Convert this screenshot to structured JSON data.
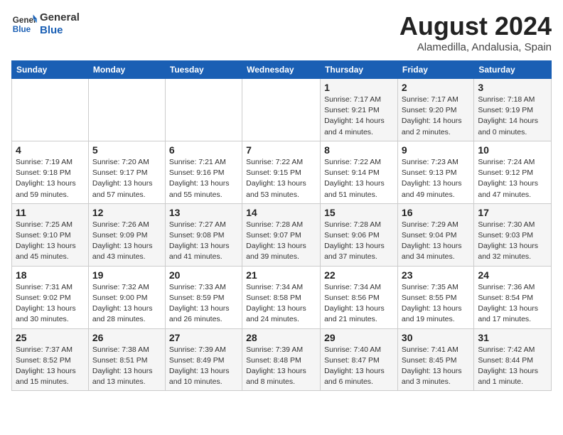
{
  "logo": {
    "line1": "General",
    "line2": "Blue"
  },
  "title": {
    "month_year": "August 2024",
    "location": "Alamedilla, Andalusia, Spain"
  },
  "days_of_week": [
    "Sunday",
    "Monday",
    "Tuesday",
    "Wednesday",
    "Thursday",
    "Friday",
    "Saturday"
  ],
  "weeks": [
    [
      {
        "day": "",
        "info": ""
      },
      {
        "day": "",
        "info": ""
      },
      {
        "day": "",
        "info": ""
      },
      {
        "day": "",
        "info": ""
      },
      {
        "day": "1",
        "info": "Sunrise: 7:17 AM\nSunset: 9:21 PM\nDaylight: 14 hours\nand 4 minutes."
      },
      {
        "day": "2",
        "info": "Sunrise: 7:17 AM\nSunset: 9:20 PM\nDaylight: 14 hours\nand 2 minutes."
      },
      {
        "day": "3",
        "info": "Sunrise: 7:18 AM\nSunset: 9:19 PM\nDaylight: 14 hours\nand 0 minutes."
      }
    ],
    [
      {
        "day": "4",
        "info": "Sunrise: 7:19 AM\nSunset: 9:18 PM\nDaylight: 13 hours\nand 59 minutes."
      },
      {
        "day": "5",
        "info": "Sunrise: 7:20 AM\nSunset: 9:17 PM\nDaylight: 13 hours\nand 57 minutes."
      },
      {
        "day": "6",
        "info": "Sunrise: 7:21 AM\nSunset: 9:16 PM\nDaylight: 13 hours\nand 55 minutes."
      },
      {
        "day": "7",
        "info": "Sunrise: 7:22 AM\nSunset: 9:15 PM\nDaylight: 13 hours\nand 53 minutes."
      },
      {
        "day": "8",
        "info": "Sunrise: 7:22 AM\nSunset: 9:14 PM\nDaylight: 13 hours\nand 51 minutes."
      },
      {
        "day": "9",
        "info": "Sunrise: 7:23 AM\nSunset: 9:13 PM\nDaylight: 13 hours\nand 49 minutes."
      },
      {
        "day": "10",
        "info": "Sunrise: 7:24 AM\nSunset: 9:12 PM\nDaylight: 13 hours\nand 47 minutes."
      }
    ],
    [
      {
        "day": "11",
        "info": "Sunrise: 7:25 AM\nSunset: 9:10 PM\nDaylight: 13 hours\nand 45 minutes."
      },
      {
        "day": "12",
        "info": "Sunrise: 7:26 AM\nSunset: 9:09 PM\nDaylight: 13 hours\nand 43 minutes."
      },
      {
        "day": "13",
        "info": "Sunrise: 7:27 AM\nSunset: 9:08 PM\nDaylight: 13 hours\nand 41 minutes."
      },
      {
        "day": "14",
        "info": "Sunrise: 7:28 AM\nSunset: 9:07 PM\nDaylight: 13 hours\nand 39 minutes."
      },
      {
        "day": "15",
        "info": "Sunrise: 7:28 AM\nSunset: 9:06 PM\nDaylight: 13 hours\nand 37 minutes."
      },
      {
        "day": "16",
        "info": "Sunrise: 7:29 AM\nSunset: 9:04 PM\nDaylight: 13 hours\nand 34 minutes."
      },
      {
        "day": "17",
        "info": "Sunrise: 7:30 AM\nSunset: 9:03 PM\nDaylight: 13 hours\nand 32 minutes."
      }
    ],
    [
      {
        "day": "18",
        "info": "Sunrise: 7:31 AM\nSunset: 9:02 PM\nDaylight: 13 hours\nand 30 minutes."
      },
      {
        "day": "19",
        "info": "Sunrise: 7:32 AM\nSunset: 9:00 PM\nDaylight: 13 hours\nand 28 minutes."
      },
      {
        "day": "20",
        "info": "Sunrise: 7:33 AM\nSunset: 8:59 PM\nDaylight: 13 hours\nand 26 minutes."
      },
      {
        "day": "21",
        "info": "Sunrise: 7:34 AM\nSunset: 8:58 PM\nDaylight: 13 hours\nand 24 minutes."
      },
      {
        "day": "22",
        "info": "Sunrise: 7:34 AM\nSunset: 8:56 PM\nDaylight: 13 hours\nand 21 minutes."
      },
      {
        "day": "23",
        "info": "Sunrise: 7:35 AM\nSunset: 8:55 PM\nDaylight: 13 hours\nand 19 minutes."
      },
      {
        "day": "24",
        "info": "Sunrise: 7:36 AM\nSunset: 8:54 PM\nDaylight: 13 hours\nand 17 minutes."
      }
    ],
    [
      {
        "day": "25",
        "info": "Sunrise: 7:37 AM\nSunset: 8:52 PM\nDaylight: 13 hours\nand 15 minutes."
      },
      {
        "day": "26",
        "info": "Sunrise: 7:38 AM\nSunset: 8:51 PM\nDaylight: 13 hours\nand 13 minutes."
      },
      {
        "day": "27",
        "info": "Sunrise: 7:39 AM\nSunset: 8:49 PM\nDaylight: 13 hours\nand 10 minutes."
      },
      {
        "day": "28",
        "info": "Sunrise: 7:39 AM\nSunset: 8:48 PM\nDaylight: 13 hours\nand 8 minutes."
      },
      {
        "day": "29",
        "info": "Sunrise: 7:40 AM\nSunset: 8:47 PM\nDaylight: 13 hours\nand 6 minutes."
      },
      {
        "day": "30",
        "info": "Sunrise: 7:41 AM\nSunset: 8:45 PM\nDaylight: 13 hours\nand 3 minutes."
      },
      {
        "day": "31",
        "info": "Sunrise: 7:42 AM\nSunset: 8:44 PM\nDaylight: 13 hours\nand 1 minute."
      }
    ]
  ]
}
